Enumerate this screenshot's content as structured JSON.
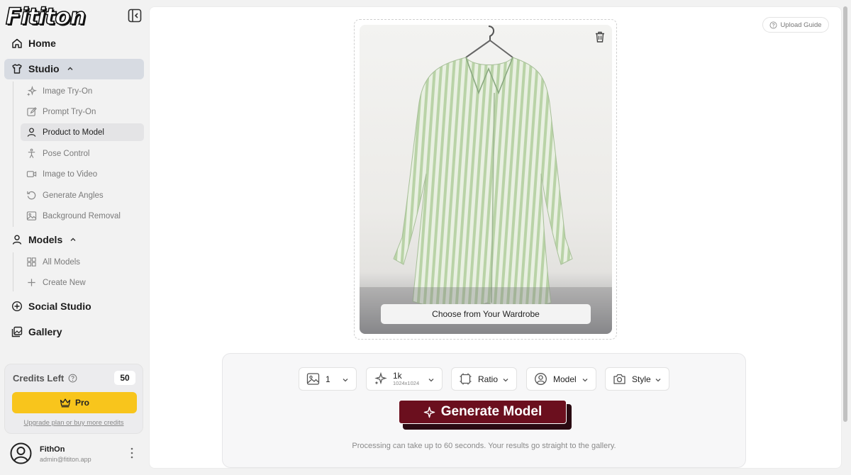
{
  "brand": {
    "logo_text": "Fititon"
  },
  "sidebar": {
    "home_label": "Home",
    "studio_label": "Studio",
    "studio_items": [
      {
        "label": "Image Try-On",
        "icon": "sparkles-icon"
      },
      {
        "label": "Prompt Try-On",
        "icon": "edit-icon"
      },
      {
        "label": "Product to Model",
        "icon": "user-icon"
      },
      {
        "label": "Pose Control",
        "icon": "figure-icon"
      },
      {
        "label": "Image to Video",
        "icon": "video-icon"
      },
      {
        "label": "Generate Angles",
        "icon": "rotate-icon"
      },
      {
        "label": "Background Removal",
        "icon": "image-icon"
      }
    ],
    "models_label": "Models",
    "models_items": [
      {
        "label": "All Models",
        "icon": "grid-icon"
      },
      {
        "label": "Create New",
        "icon": "plus-icon"
      }
    ],
    "social_label": "Social Studio",
    "gallery_label": "Gallery"
  },
  "credits": {
    "title": "Credits Left",
    "count": "50",
    "pro_label": "Pro",
    "upgrade_link": "Upgrade plan or buy more credits"
  },
  "user": {
    "name": "FithOn",
    "email": "admin@fititon.app"
  },
  "main": {
    "upload_guide": "Upload Guide",
    "wardrobe_button": "Choose from Your Wardrobe",
    "options": {
      "count": "1",
      "resolution": "1k",
      "resolution_sub": "1024x1024",
      "ratio": "Ratio",
      "model": "Model",
      "style": "Style"
    },
    "generate_button": "Generate Model",
    "processing_note": "Processing can take up to 60 seconds. Your results go straight to the gallery."
  },
  "colors": {
    "accent": "#6b0f1e",
    "pro": "#f8c51c",
    "active_bg": "#d7dbe2"
  }
}
